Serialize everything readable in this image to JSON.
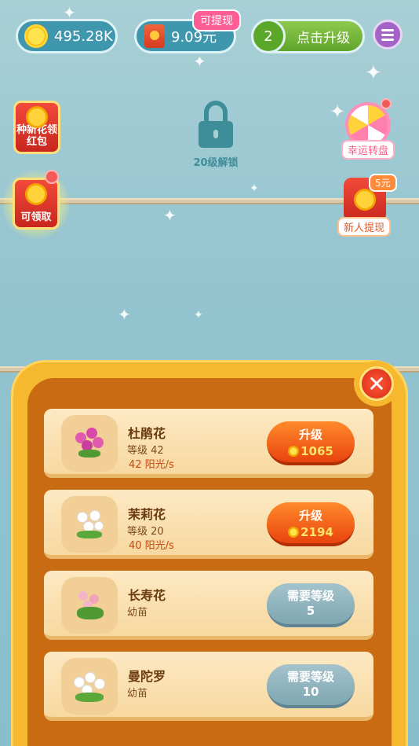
{
  "topbar": {
    "sun_amount": "495.28K",
    "cash_amount": "9.09元",
    "cash_badge": "可提现",
    "level_number": "2",
    "upgrade_label": "点击升级"
  },
  "side_left": {
    "redpack_plant_label": "种新花领红包",
    "redpack_claim_label": "可领取"
  },
  "lock": {
    "label": "20级解锁"
  },
  "side_right": {
    "wheel_label": "幸运转盘",
    "newuser_label": "新人提现",
    "newuser_badge": "5元"
  },
  "flowers": [
    {
      "name": "杜鹃花",
      "level": "等级 42",
      "rate": "42 阳光/s",
      "button": "升级",
      "cost": "1065",
      "state": "upgrade"
    },
    {
      "name": "茉莉花",
      "level": "等级 20",
      "rate": "40 阳光/s",
      "button": "升级",
      "cost": "2194",
      "state": "upgrade"
    },
    {
      "name": "长寿花",
      "level": "幼苗",
      "rate": "",
      "button": "需要等级",
      "need_level": "5",
      "state": "locked"
    },
    {
      "name": "曼陀罗",
      "level": "幼苗",
      "rate": "",
      "button": "需要等级",
      "need_level": "10",
      "state": "locked"
    }
  ],
  "colors": {
    "sky": "#93c4cf",
    "panel_gold": "#f6b82e",
    "panel_brown": "#c96b12",
    "upgrade_orange": "#e9440f",
    "locked_blue": "#7fa6b2"
  }
}
